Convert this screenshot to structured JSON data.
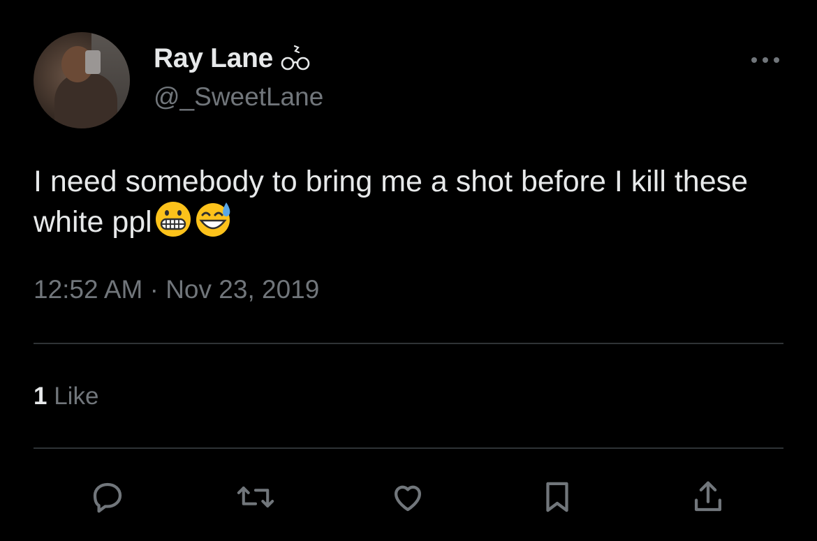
{
  "tweet": {
    "author": {
      "display_name": "Ray Lane",
      "name_emoji": "glasses-with-sparkle-emoji",
      "handle": "@_SweetLane"
    },
    "text": "I need somebody to bring me a shot before I kill these white ppl",
    "text_emojis": [
      "grimacing-face-emoji",
      "grinning-face-with-sweat-emoji"
    ],
    "timestamp": "12:52 AM · Nov 23, 2019",
    "likes": {
      "count": "1",
      "label": "Like"
    }
  },
  "actions": [
    {
      "icon": "reply-icon"
    },
    {
      "icon": "retweet-icon"
    },
    {
      "icon": "like-heart-icon"
    },
    {
      "icon": "bookmark-icon"
    },
    {
      "icon": "share-icon"
    }
  ],
  "colors": {
    "background": "#000000",
    "primary_text": "#e7e9ea",
    "secondary_text": "#71767b",
    "divider": "#2f3336",
    "icon": "#71767b"
  }
}
